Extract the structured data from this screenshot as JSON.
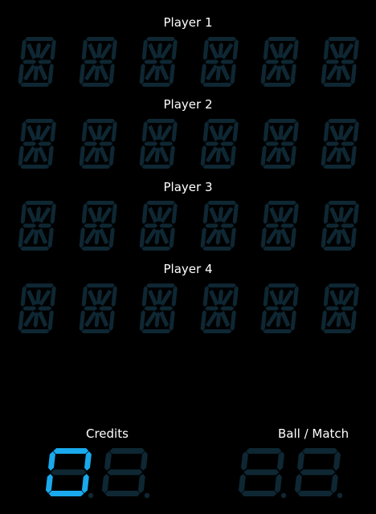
{
  "players": [
    {
      "label": "Player 1",
      "display": "      "
    },
    {
      "label": "Player 2",
      "display": "      "
    },
    {
      "label": "Player 3",
      "display": "      "
    },
    {
      "label": "Player 4",
      "display": "      "
    }
  ],
  "credits": {
    "label": "Credits",
    "digits": [
      "0",
      " "
    ]
  },
  "ball_match": {
    "label": "Ball / Match",
    "digits": [
      " ",
      " "
    ]
  },
  "colors": {
    "lit_segment": "#19a9ec",
    "unlit_segment": "#0e2733",
    "background": "#000000",
    "label_text": "#ffffff"
  }
}
